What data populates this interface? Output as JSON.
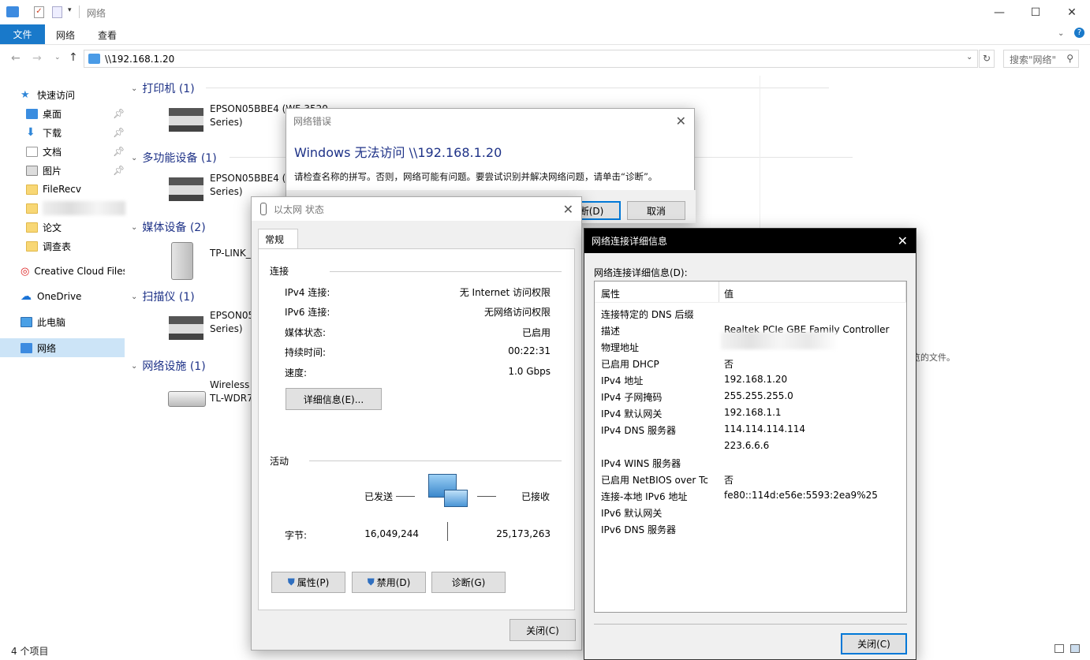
{
  "window": {
    "title": "网络"
  },
  "ribbon": {
    "file": "文件",
    "tabs": [
      "网络",
      "查看"
    ]
  },
  "address": {
    "path": "\\\\192.168.1.20",
    "search_placeholder": "搜索\"网络\""
  },
  "nav": {
    "items": [
      "快速访问",
      "桌面",
      "下载",
      "文档",
      "图片",
      "FileRecv",
      "",
      "论文",
      "调查表",
      "Creative Cloud Files",
      "OneDrive",
      "此电脑",
      "网络"
    ]
  },
  "groups": [
    {
      "title": "打印机 (1)",
      "items": [
        [
          "EPSON05BBE4 (WF-3520",
          "Series)"
        ]
      ]
    },
    {
      "title": "多功能设备 (1)",
      "items": [
        [
          "EPSON05BBE4 (W",
          "Series)"
        ]
      ]
    },
    {
      "title": "媒体设备 (2)",
      "items": [
        [
          "TP-LINK_",
          ""
        ]
      ]
    },
    {
      "title": "扫描仪 (1)",
      "items": [
        [
          "EPSON05",
          "Series)"
        ]
      ]
    },
    {
      "title": "网络设施 (1)",
      "items": [
        [
          "Wireless",
          "TL-WDR7"
        ]
      ]
    }
  ],
  "statusbar": {
    "count": "4 个项目"
  },
  "preview": {
    "hint": "览的文件。"
  },
  "err": {
    "title": "网络错误",
    "heading": "Windows 无法访问 \\\\192.168.1.20",
    "message": "请检查名称的拼写。否则，网络可能有问题。要尝试识别并解决网络问题，请单击“诊断”。",
    "diag_btn": "断(D)",
    "cancel_btn": "取消"
  },
  "eth": {
    "title": "以太网 状态",
    "tab": "常规",
    "conn_section": "连接",
    "rows": [
      [
        "IPv4 连接:",
        "无 Internet 访问权限"
      ],
      [
        "IPv6 连接:",
        "无网络访问权限"
      ],
      [
        "媒体状态:",
        "已启用"
      ],
      [
        "持续时间:",
        "00:22:31"
      ],
      [
        "速度:",
        "1.0 Gbps"
      ]
    ],
    "details_btn": "详细信息(E)...",
    "act_section": "活动",
    "sent": "已发送",
    "recv": "已接收",
    "bytes_label": "字节:",
    "bytes_sent": "16,049,244",
    "bytes_recv": "25,173,263",
    "props_btn": "属性(P)",
    "disable_btn": "禁用(D)",
    "diagnose_btn": "诊断(G)",
    "close_btn": "关闭(C)"
  },
  "detail": {
    "title": "网络连接详细信息",
    "label": "网络连接详细信息(D):",
    "col_prop": "属性",
    "col_val": "值",
    "rows": [
      [
        "连接特定的 DNS 后缀",
        ""
      ],
      [
        "描述",
        "Realtek PCIe GBE Family Controller"
      ],
      [
        "物理地址",
        ""
      ],
      [
        "已启用 DHCP",
        "否"
      ],
      [
        "IPv4 地址",
        "192.168.1.20"
      ],
      [
        "IPv4 子网掩码",
        "255.255.255.0"
      ],
      [
        "IPv4 默认网关",
        "192.168.1.1"
      ],
      [
        "IPv4 DNS 服务器",
        "114.114.114.114"
      ],
      [
        "",
        "223.6.6.6"
      ],
      [
        "IPv4 WINS 服务器",
        ""
      ],
      [
        "已启用 NetBIOS over Tc",
        "否"
      ],
      [
        "连接-本地 IPv6 地址",
        "fe80::114d:e56e:5593:2ea9%25"
      ],
      [
        "IPv6 默认网关",
        ""
      ],
      [
        "IPv6 DNS 服务器",
        ""
      ]
    ],
    "close_btn": "关闭(C)"
  }
}
